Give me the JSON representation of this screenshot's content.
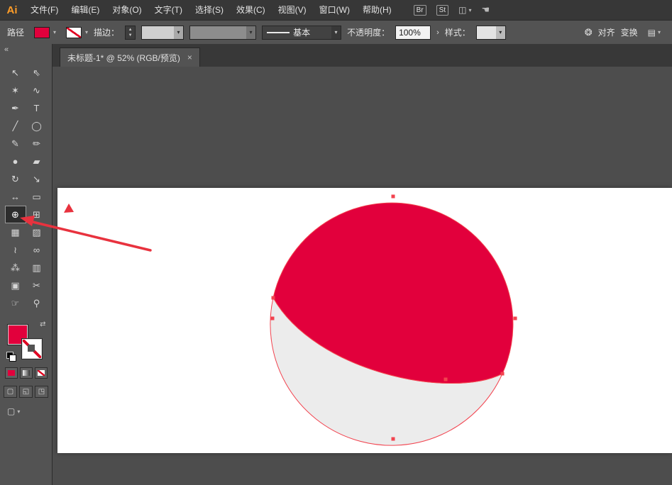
{
  "menubar": {
    "logo": "Ai",
    "items": [
      {
        "label": "文件(F)"
      },
      {
        "label": "编辑(E)"
      },
      {
        "label": "对象(O)"
      },
      {
        "label": "文字(T)"
      },
      {
        "label": "选择(S)"
      },
      {
        "label": "效果(C)"
      },
      {
        "label": "视图(V)"
      },
      {
        "label": "窗口(W)"
      },
      {
        "label": "帮助(H)"
      }
    ],
    "bridge_badge": "Br",
    "stock_badge": "St",
    "workspace_icon": "◫",
    "workspace_arrow": "▾",
    "cslive_icon": "☚"
  },
  "control_bar": {
    "path_label": "路径",
    "stroke_label": "描边：",
    "brush_basic": "基本",
    "opacity_label": "不透明度：",
    "opacity_value": "100%",
    "opacity_flyout": "›",
    "style_label": "样式：",
    "globe_icon": "❂",
    "align_label": "对齐",
    "transform_label": "变换",
    "panel_menu_icon": "▤"
  },
  "tabbar": {
    "document_tab": {
      "title": "未标题-1* @ 52% (RGB/预览)",
      "close": "×"
    }
  },
  "toolbar": {
    "collapse": "«",
    "swap_icon": "⇄",
    "screen_mode_icon": "▢",
    "tools": [
      {
        "name": "selection-tool",
        "glyph": "↖"
      },
      {
        "name": "direct-selection-tool",
        "glyph": "⇖"
      },
      {
        "name": "magic-wand-tool",
        "glyph": "✶"
      },
      {
        "name": "lasso-tool",
        "glyph": "∿"
      },
      {
        "name": "pen-tool",
        "glyph": "✒"
      },
      {
        "name": "type-tool",
        "glyph": "T"
      },
      {
        "name": "line-segment-tool",
        "glyph": "╱"
      },
      {
        "name": "ellipse-tool",
        "glyph": "◯"
      },
      {
        "name": "paintbrush-tool",
        "glyph": "✎"
      },
      {
        "name": "pencil-tool",
        "glyph": "✏"
      },
      {
        "name": "blob-brush-tool",
        "glyph": "●"
      },
      {
        "name": "eraser-tool",
        "glyph": "▰"
      },
      {
        "name": "rotate-tool",
        "glyph": "↻"
      },
      {
        "name": "scale-tool",
        "glyph": "↘"
      },
      {
        "name": "width-tool",
        "glyph": "↔"
      },
      {
        "name": "free-transform-tool",
        "glyph": "▭"
      },
      {
        "name": "shape-builder-tool",
        "glyph": "⊕",
        "active": true
      },
      {
        "name": "perspective-grid-tool",
        "glyph": "⊞"
      },
      {
        "name": "mesh-tool",
        "glyph": "▦"
      },
      {
        "name": "gradient-tool",
        "glyph": "▨"
      },
      {
        "name": "eyedropper-tool",
        "glyph": "≀"
      },
      {
        "name": "blend-tool",
        "glyph": "∞"
      },
      {
        "name": "symbol-sprayer-tool",
        "glyph": "⁂"
      },
      {
        "name": "column-graph-tool",
        "glyph": "▥"
      },
      {
        "name": "artboard-tool",
        "glyph": "▣"
      },
      {
        "name": "slice-tool",
        "glyph": "✂"
      },
      {
        "name": "hand-tool",
        "glyph": "☞"
      },
      {
        "name": "zoom-tool",
        "glyph": "⚲"
      }
    ]
  },
  "colors": {
    "accent": "#e2003c",
    "selection_red": "#f2434f",
    "annotation_red": "#e8323e",
    "lens_gray": "#ececec",
    "menubar_bg": "#373737",
    "panel_bg": "#535353",
    "pasteboard": "#4d4d4d",
    "artboard": "#ffffff",
    "text_light": "#e3e3e3"
  }
}
